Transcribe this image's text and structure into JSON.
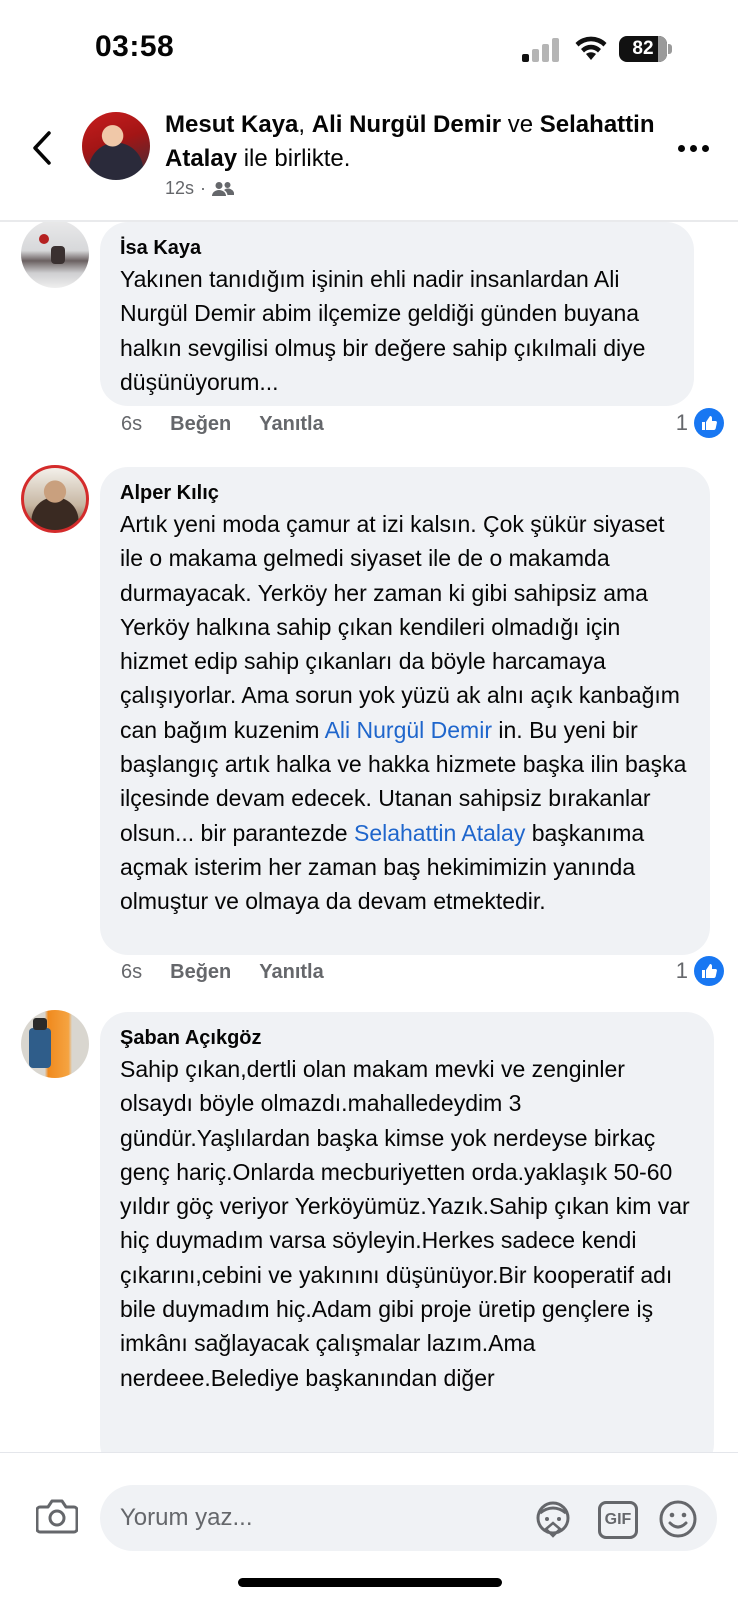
{
  "status_bar": {
    "time": "03:58",
    "battery_level": "82",
    "battery_fraction": 0.82
  },
  "header": {
    "author_1": "Mesut Kaya",
    "sep_1": ", ",
    "author_2": "Ali Nurgül Demir",
    "sep_2": " ve ",
    "author_3": "Selahattin Atalay",
    "suffix": " ile birlikte.",
    "time": "12s",
    "dot": "·",
    "audience_icon": "friends-icon"
  },
  "comments": [
    {
      "name": "İsa Kaya",
      "text": "Yakınen tanıdığım işinin ehli nadir insanlardan Ali Nurgül Demir abim ilçemize geldiği günden buyana halkın sevgilisi olmuş bir değere sahip çıkılmali diye düşünüyorum...",
      "time": "6s",
      "like": "Beğen",
      "reply": "Yanıtla",
      "reactions": "1"
    },
    {
      "name": "Alper Kılıç",
      "text_1": "Artık yeni moda çamur at izi kalsın. Çok şükür siyaset ile o makama gelmedi siyaset ile de o makamda durmayacak. Yerköy her zaman ki gibi sahipsiz ama Yerköy halkına sahip çıkan kendileri olmadığı için hizmet edip sahip çıkanları da böyle harcamaya çalışıyorlar. Ama sorun yok yüzü ak alnı açık kanbağım can bağım kuzenim ",
      "mention_1": "Ali Nurgül Demir",
      "text_2": " in. Bu yeni bir başlangıç artık halka ve hakka hizmete başka ilin başka ilçesinde devam edecek. Utanan sahipsiz bırakanlar olsun... bir parantezde ",
      "mention_2": "Selahattin Atalay",
      "text_3": " başkanıma açmak isterim her zaman baş hekimimizin yanında olmuştur ve olmaya da devam etmektedir.",
      "time": "6s",
      "like": "Beğen",
      "reply": "Yanıtla",
      "reactions": "1"
    },
    {
      "name": "Şaban Açıkgöz",
      "text": "Sahip çıkan,dertli olan makam mevki ve zenginler olsaydı böyle olmazdı.mahalledeydim 3 gündür.Yaşlılardan başka kimse yok nerdeyse birkaç genç hariç.Onlarda mecburiyetten orda.yaklaşık 50-60 yıldır göç veriyor Yerköyümüz.Yazık.Sahip çıkan kim var hiç duymadım varsa söyleyin.Herkes sadece kendi çıkarını,cebini ve yakınını düşünüyor.Bir kooperatif adı bile duymadım hiç.Adam gibi proje üretip gençlere iş imkânı sağlayacak  çalışmalar lazım.Ama nerdeee.Belediye başkanından diğer"
    }
  ],
  "composer": {
    "placeholder": "Yorum yaz...",
    "gif_label": "GIF"
  },
  "colors": {
    "mention": "#1f66cc",
    "like_blue": "#1877f2",
    "bubble_bg": "#f0f2f5",
    "secondary_text": "#65676b"
  }
}
